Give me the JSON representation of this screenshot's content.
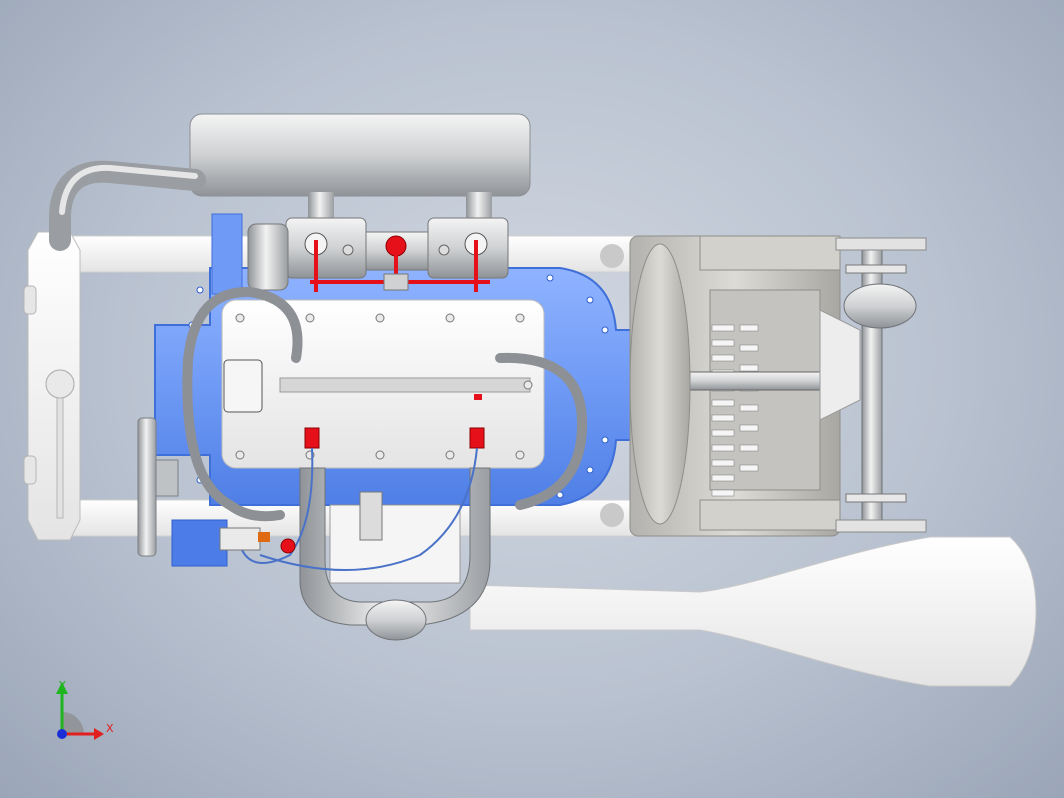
{
  "viewport": {
    "background_top": "#d2d8e2",
    "background_edge": "#9aa5b7"
  },
  "model": {
    "colors": {
      "block_blue": "#6f9af5",
      "block_blue_dark": "#3f6fd8",
      "silver": "#d9dadb",
      "silver_dark": "#9ea2a6",
      "white_part": "#f3f3f3",
      "red_part": "#e5101a",
      "cable_blue": "#4a72c8",
      "orange_part": "#e06a12",
      "gray_housing": "#c7c6c2"
    }
  },
  "triad": {
    "x_label": "X",
    "y_label": "Y",
    "x_color": "#e21e1e",
    "y_color": "#1fb51f",
    "z_color": "#1c2fd6"
  }
}
